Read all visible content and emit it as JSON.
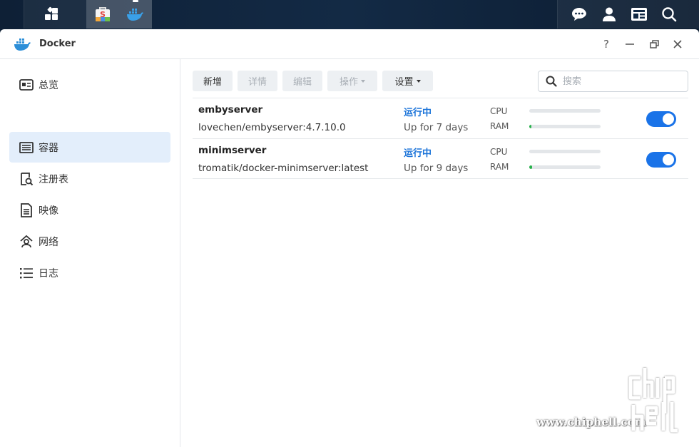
{
  "taskbar": {
    "apps": [
      {
        "icon": "grid-icon"
      },
      {
        "icon": "package-center-icon"
      },
      {
        "icon": "docker-icon",
        "active": true
      }
    ],
    "right_icons": [
      "chat-icon",
      "user-icon",
      "widgets-icon",
      "search-icon"
    ]
  },
  "window": {
    "title": "Docker",
    "controls": {
      "help": "?"
    }
  },
  "sidebar": {
    "items": [
      {
        "label": "总览",
        "icon": "overview-icon"
      },
      {
        "label": "容器",
        "icon": "container-icon",
        "active": true
      },
      {
        "label": "注册表",
        "icon": "registry-icon"
      },
      {
        "label": "映像",
        "icon": "image-icon"
      },
      {
        "label": "网络",
        "icon": "network-icon"
      },
      {
        "label": "日志",
        "icon": "log-icon"
      }
    ]
  },
  "toolbar": {
    "new_label": "新增",
    "details_label": "详情",
    "edit_label": "编辑",
    "action_label": "操作",
    "settings_label": "设置",
    "search_placeholder": "搜索"
  },
  "containers": [
    {
      "name": "embyserver",
      "image": "lovechen/embyserver:4.7.10.0",
      "status": "运行中",
      "uptime": "Up for 7 days",
      "cpu_label": "CPU",
      "ram_label": "RAM",
      "cpu_usage": 0,
      "ram_usage": 0.03,
      "enabled": true
    },
    {
      "name": "minimserver",
      "image": "tromatik/docker-minimserver:latest",
      "status": "运行中",
      "uptime": "Up for 9 days",
      "cpu_label": "CPU",
      "ram_label": "RAM",
      "cpu_usage": 0,
      "ram_usage": 0.04,
      "enabled": true
    }
  ],
  "watermark": {
    "url": "www.chiphell.com",
    "logo": "chip hell"
  },
  "colors": {
    "accent": "#1a73e8",
    "status_running": "#1a73d9",
    "ram_bar": "#27b14a",
    "sidebar_active": "#e3eefb"
  }
}
